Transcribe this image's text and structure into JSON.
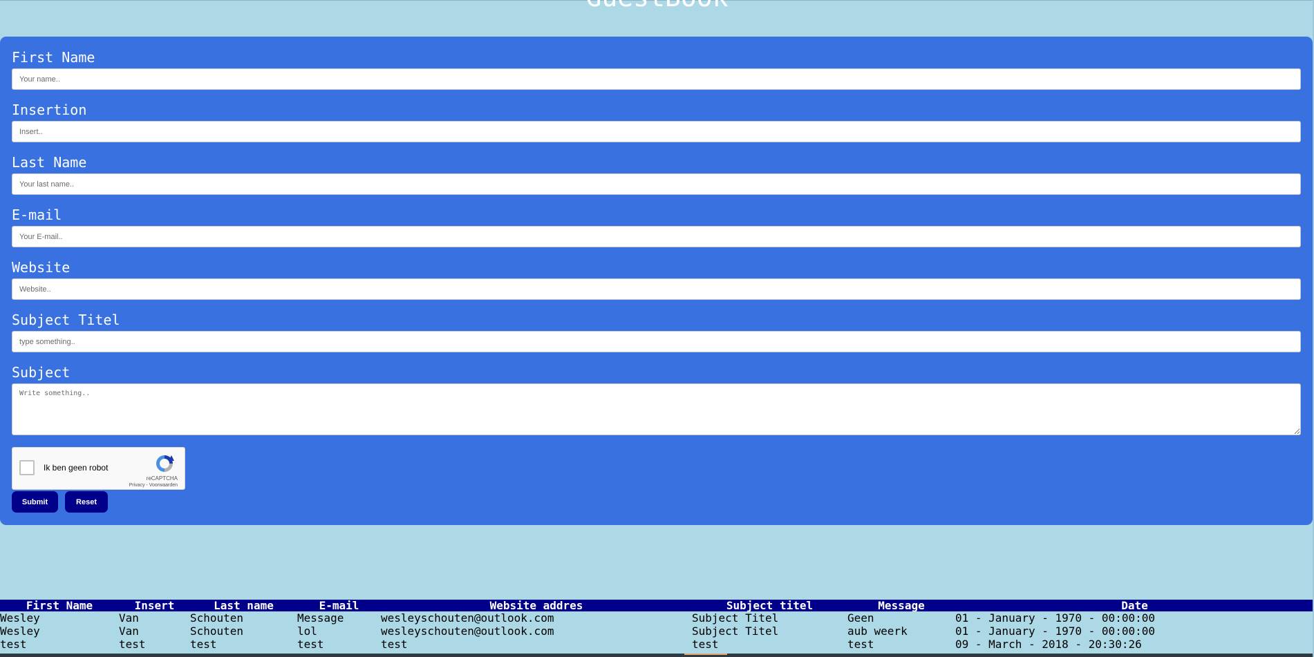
{
  "page": {
    "title": "GuestBook"
  },
  "form": {
    "fields": [
      {
        "label": "First Name",
        "placeholder": "Your name.."
      },
      {
        "label": "Insertion",
        "placeholder": "Insert.."
      },
      {
        "label": "Last Name",
        "placeholder": "Your last name.."
      },
      {
        "label": "E-mail",
        "placeholder": "Your E-mail.."
      },
      {
        "label": "Website",
        "placeholder": "Website.."
      },
      {
        "label": "Subject Titel",
        "placeholder": "type something.."
      }
    ],
    "subject": {
      "label": "Subject",
      "placeholder": "Write something.."
    },
    "captcha": {
      "label": "Ik ben geen robot",
      "brand": "reCAPTCHA",
      "terms": "Privacy - Voorwaarden",
      "logo_icon": "recaptcha-logo-icon"
    },
    "submit_label": "Submit",
    "reset_label": "Reset"
  },
  "colors": {
    "page_background": "#add8e6",
    "form_background": "#3971e0",
    "button_background": "#00008b",
    "table_header_background": "#00008b"
  },
  "table": {
    "headers": [
      "First Name",
      "Insert",
      "Last name",
      "E-mail",
      "Website addres",
      "Subject titel",
      "Message",
      "Date"
    ],
    "rows": [
      [
        "Wesley",
        "Van",
        "Schouten",
        "Message",
        "wesleyschouten@outlook.com",
        "Subject Titel",
        "Geen",
        "01 - January - 1970 - 00:00:00"
      ],
      [
        "Wesley",
        "Van",
        "Schouten",
        "lol",
        "wesleyschouten@outlook.com",
        "Subject Titel",
        "aub weerk",
        "01 - January - 1970 - 00:00:00"
      ],
      [
        "test",
        "test",
        "test",
        "test",
        "test",
        "test",
        "test",
        "09 - March - 2018 - 20:30:26"
      ]
    ]
  }
}
